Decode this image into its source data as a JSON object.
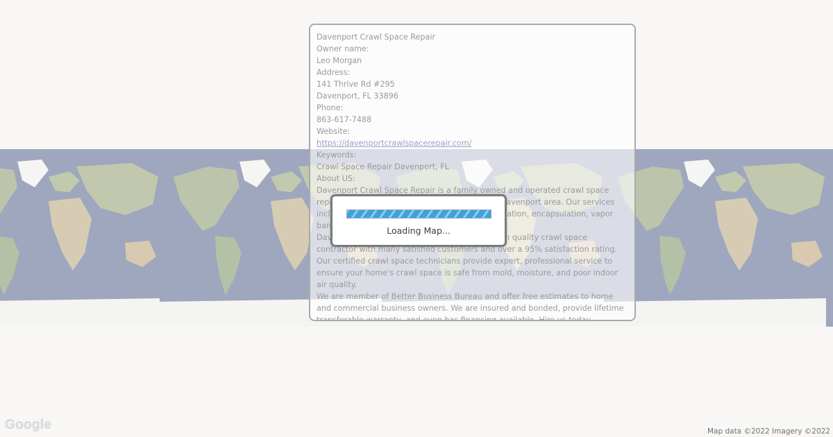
{
  "business": {
    "name": "Davenport Crawl Space Repair",
    "owner_label": "Owner name:",
    "owner": "Leo Morgan",
    "address_label": "Address:",
    "street": "141 Thrive Rd #295",
    "city": "Davenport, FL 33896",
    "phone_label": "Phone:",
    "phone": "863-617-7488",
    "website_label": "Website:",
    "website": "https://davenportcrawlspacerepair.com/",
    "keywords_label": "Keywords:",
    "keywords": "Crawl Space Repair Davenport, FL",
    "about_label": "About US:",
    "about_paragraphs": [
      "Davenport Crawl Space Repair is a family owned and operated crawl space repair and waterproofing company serving the Davenport area. Our services include crawl space drainage, sump pump installation, encapsulation, vapor barriers, dirt removal, and more.",
      "Davenport Crawl Space Repair is the leading high quality crawl space contractor with many satisfied customers and over a 95% satisfaction rating. Our certified crawl space technicians provide expert, professional service to ensure your home's crawl space is safe from mold, moisture, and poor indoor air quality.",
      "We are member of Better Business Bureau and offer free estimates to home and commercial business owners. We are insured and bonded, provide lifetime transferable warranty, and even has financing available. Hire us today."
    ]
  },
  "loader": {
    "text": "Loading Map...",
    "progress_icon": "striped-progress-bar"
  },
  "map": {
    "logo": "Google",
    "attribution": "Map data ©2022 Imagery ©2022"
  },
  "colors": {
    "ocean": "#2c3f74",
    "land": "#7a8d52",
    "ice": "#f2f2f2",
    "progress": "#3fa2d8"
  }
}
